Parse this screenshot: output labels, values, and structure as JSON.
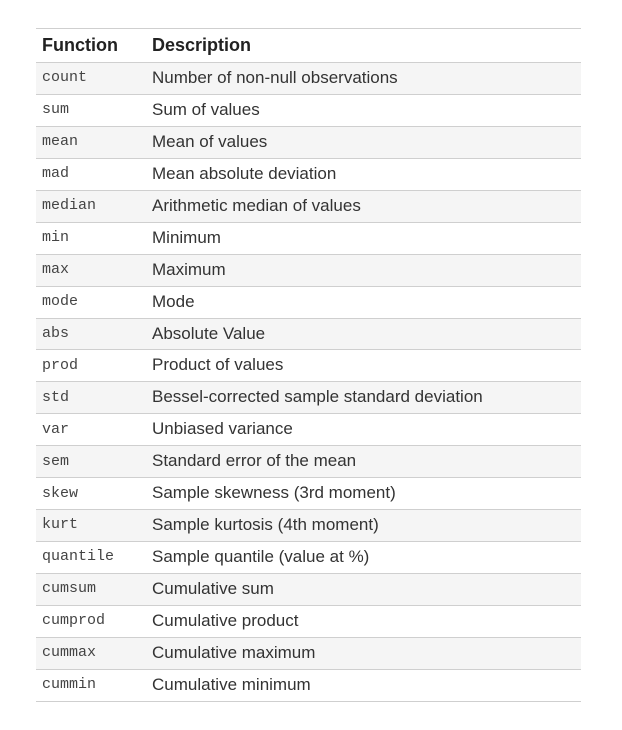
{
  "headers": {
    "col1": "Function",
    "col2": "Description"
  },
  "rows": [
    {
      "fn": "count",
      "desc": "Number of non-null observations"
    },
    {
      "fn": "sum",
      "desc": "Sum of values"
    },
    {
      "fn": "mean",
      "desc": "Mean of values"
    },
    {
      "fn": "mad",
      "desc": "Mean absolute deviation"
    },
    {
      "fn": "median",
      "desc": "Arithmetic median of values"
    },
    {
      "fn": "min",
      "desc": "Minimum"
    },
    {
      "fn": "max",
      "desc": "Maximum"
    },
    {
      "fn": "mode",
      "desc": "Mode"
    },
    {
      "fn": "abs",
      "desc": "Absolute Value"
    },
    {
      "fn": "prod",
      "desc": "Product of values"
    },
    {
      "fn": "std",
      "desc": "Bessel-corrected sample standard deviation"
    },
    {
      "fn": "var",
      "desc": "Unbiased variance"
    },
    {
      "fn": "sem",
      "desc": "Standard error of the mean"
    },
    {
      "fn": "skew",
      "desc": "Sample skewness (3rd moment)"
    },
    {
      "fn": "kurt",
      "desc": "Sample kurtosis (4th moment)"
    },
    {
      "fn": "quantile",
      "desc": "Sample quantile (value at %)"
    },
    {
      "fn": "cumsum",
      "desc": "Cumulative sum"
    },
    {
      "fn": "cumprod",
      "desc": "Cumulative product"
    },
    {
      "fn": "cummax",
      "desc": "Cumulative maximum"
    },
    {
      "fn": "cummin",
      "desc": "Cumulative minimum"
    }
  ]
}
